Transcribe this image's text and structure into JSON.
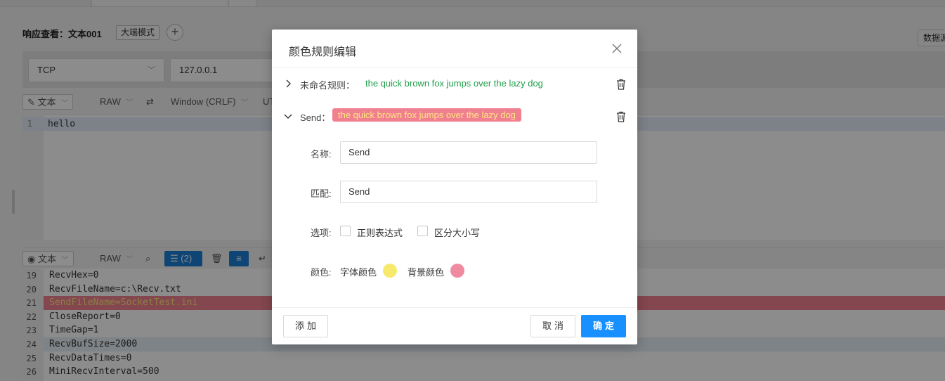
{
  "app": {
    "response_title": "响应查看：文本001",
    "mode_button": "大端模式",
    "add_symbol": "+",
    "data_button": "数据源",
    "protocol": "TCP",
    "host": "127.0.0.1",
    "toolbar1": {
      "view_mode": "文本",
      "format": "RAW",
      "line_ending": "Window (CRLF)",
      "encoding": "UT"
    },
    "editor1": {
      "line_number": "1",
      "content": "hello"
    },
    "toolbar2": {
      "view_mode": "文本",
      "format": "RAW",
      "rules_count": "(2)"
    },
    "log_lines": [
      {
        "num": "19",
        "text": "RecvHex=0"
      },
      {
        "num": "20",
        "text": "RecvFileName=c:\\Recv.txt"
      },
      {
        "num": "21",
        "text": "SendFileName=SocketTest.ini"
      },
      {
        "num": "22",
        "text": "CloseReport=0"
      },
      {
        "num": "23",
        "text": "TimeGap=1"
      },
      {
        "num": "24",
        "text": "RecvBufSize=2000"
      },
      {
        "num": "25",
        "text": "RecvDataTimes=0"
      },
      {
        "num": "26",
        "text": "MiniRecvInterval=500"
      }
    ]
  },
  "dialog": {
    "title": "颜色规则编辑",
    "rules": [
      {
        "label": "未命名规则：",
        "sample": "the quick brown fox jumps over the lazy dog",
        "text_color": "#1f9f4a",
        "bg_color": ""
      },
      {
        "label": "Send：",
        "sample": "the quick brown fox jumps over the lazy dog",
        "text_color": "#ffe680",
        "bg_color": "#f08090"
      }
    ],
    "form": {
      "name_label": "名称:",
      "name_value": "Send",
      "match_label": "匹配:",
      "match_value": "Send",
      "options_label": "选项:",
      "option_regex": "正则表达式",
      "option_case": "区分大小写",
      "color_label": "颜色:",
      "font_color_label": "字体颜色",
      "font_color": "#f7e96b",
      "bg_color_label": "背景颜色",
      "bg_color": "#f08aa0"
    },
    "footer": {
      "add": "添加",
      "cancel": "取消",
      "ok": "确定"
    }
  }
}
